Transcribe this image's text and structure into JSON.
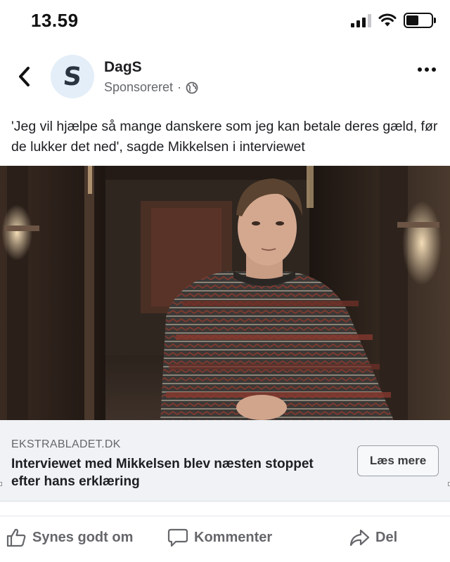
{
  "status_bar": {
    "time": "13.59",
    "battery_level": 0.5,
    "icons": [
      "cellular-signal-icon",
      "wifi-icon",
      "battery-icon"
    ]
  },
  "post": {
    "page_name": "DagS",
    "avatar_letter": "S",
    "sponsored_label": "Sponsoreret",
    "separator": "·",
    "privacy_icon": "globe-icon",
    "caption": "'Jeg vil hjælpe så mange danskere som jeg kan betale deres gæld, før de lukker det ned', sagde Mikkelsen i interviewet"
  },
  "link_preview": {
    "domain": "EKSTRABLADET.DK",
    "title": "Interviewet med Mikkelsen blev næsten stoppet efter hans erklæring",
    "cta_label": "Læs mere"
  },
  "actions": {
    "like_label": "Synes godt om",
    "comment_label": "Kommenter",
    "share_label": "Del"
  },
  "colors": {
    "secondary_text": "#65676b",
    "preview_bg": "#f0f2f5",
    "avatar_bg": "#e4eef8"
  }
}
